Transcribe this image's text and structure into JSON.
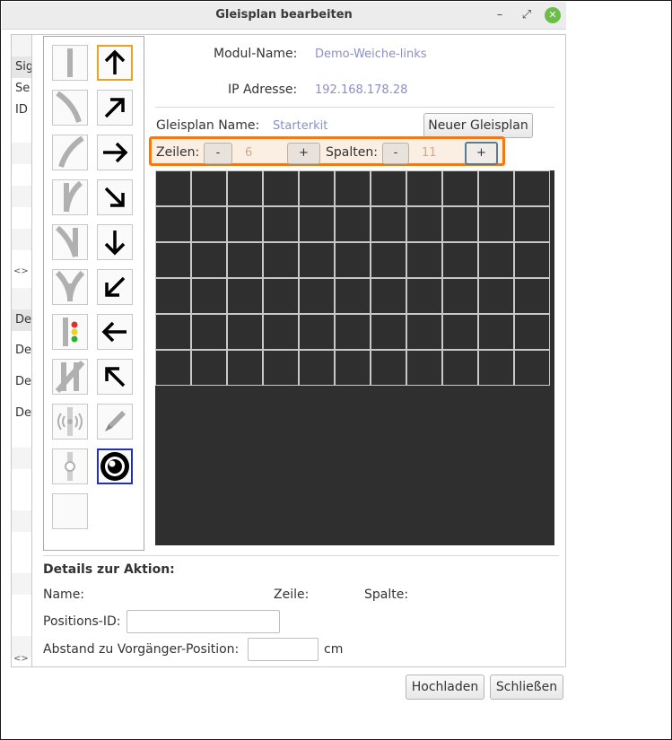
{
  "window": {
    "title": "Gleisplan bearbeiten",
    "minimize": "–",
    "restore": "⤢",
    "close": "✕"
  },
  "left_strip": {
    "items_top": [
      "Sig",
      "Se",
      "ID"
    ],
    "items_bottom": [
      "De",
      "De",
      "De",
      "De"
    ],
    "arrows": "<>"
  },
  "palette": {
    "tiles": [
      "track-straight-icon",
      "arrow-up-icon",
      "track-curve-left-icon",
      "arrow-up-right-icon",
      "track-curve-right-icon",
      "arrow-right-icon",
      "switch-right-icon",
      "arrow-down-right-icon",
      "switch-left-icon",
      "arrow-down-icon",
      "switch-three-way-icon",
      "arrow-down-left-icon",
      "signal-light-icon",
      "arrow-left-icon",
      "crossing-switch-icon",
      "arrow-up-left-icon",
      "sensor-icon",
      "pencil-icon",
      "isolator-icon",
      "eye-icon",
      "empty-tile"
    ]
  },
  "module": {
    "name_label": "Modul-Name:",
    "name_value": "Demo-Weiche-links",
    "ip_label": "IP Adresse:",
    "ip_value": "192.168.178.28"
  },
  "plan": {
    "name_label": "Gleisplan Name:",
    "name_value": "Starterkit",
    "new_button": "Neuer Gleisplan"
  },
  "dimensions": {
    "rows_label": "Zeilen:",
    "rows_minus": "-",
    "rows_value": "6",
    "rows_plus": "+",
    "cols_label": "Spalten:",
    "cols_minus": "-",
    "cols_value": "11",
    "cols_plus": "+"
  },
  "grid": {
    "rows": 6,
    "cols": 11
  },
  "details": {
    "heading": "Details zur Aktion:",
    "name_label": "Name:",
    "row_label": "Zeile:",
    "col_label": "Spalte:",
    "position_id_label": "Positions-ID:",
    "position_id_value": "",
    "distance_label": "Abstand zu Vorgänger-Position:",
    "distance_value": "",
    "distance_unit": "cm"
  },
  "footer": {
    "upload_button": "Hochladen",
    "close_button": "Schließen"
  },
  "colors": {
    "highlight_border": "#ee7a1a",
    "grid_background": "#2f2f2f",
    "value_text": "#8a8fc8",
    "close_button": "#6bbf48"
  }
}
